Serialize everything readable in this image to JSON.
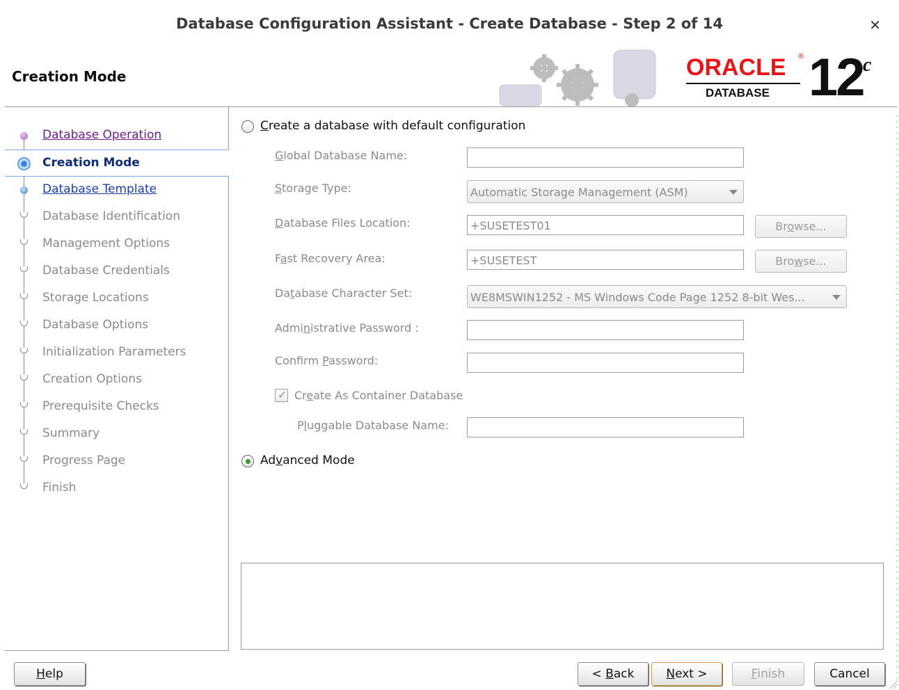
{
  "window": {
    "title": "Database Configuration Assistant - Create Database - Step 2 of 14",
    "close_glyph": "✕"
  },
  "header": {
    "page_heading": "Creation Mode",
    "brand": {
      "oracle_word": "ORACLE",
      "reg_mark": "®",
      "database_word": "DATABASE",
      "version": "12",
      "version_suffix": "c",
      "color": "#e8141a"
    }
  },
  "nav": {
    "items": [
      {
        "label": "Database Operation",
        "state": "visited"
      },
      {
        "label": "Creation Mode",
        "state": "current"
      },
      {
        "label": "Database Template",
        "state": "next"
      },
      {
        "label": "Database Identification",
        "state": "pending"
      },
      {
        "label": "Management Options",
        "state": "pending"
      },
      {
        "label": "Database Credentials",
        "state": "pending"
      },
      {
        "label": "Storage Locations",
        "state": "pending"
      },
      {
        "label": "Database Options",
        "state": "pending"
      },
      {
        "label": "Initialization Parameters",
        "state": "pending"
      },
      {
        "label": "Creation Options",
        "state": "pending"
      },
      {
        "label": "Prerequisite Checks",
        "state": "pending"
      },
      {
        "label": "Summary",
        "state": "pending"
      },
      {
        "label": "Progress Page",
        "state": "pending"
      },
      {
        "label": "Finish",
        "state": "pending"
      }
    ]
  },
  "form": {
    "default_config": {
      "label_mnemonic": "C",
      "label_rest": "reate a database with default configuration",
      "selected": false
    },
    "global_db_name": {
      "label_mnemonic": "G",
      "label_rest": "lobal Database Name:",
      "value": ""
    },
    "storage_type": {
      "label_mnemonic": "S",
      "label_rest": "torage Type:",
      "value": "Automatic Storage Management (ASM)"
    },
    "db_files_location": {
      "label_mnemonic": "D",
      "label_rest": "atabase Files Location:",
      "value": "+SUSETEST01",
      "browse_pre": "Br",
      "browse_mnemonic": "o",
      "browse_post": "wse..."
    },
    "fast_recovery_area": {
      "label_pre": "F",
      "label_mnemonic": "a",
      "label_rest": "st Recovery Area:",
      "value": "+SUSETEST",
      "browse_pre": "Bro",
      "browse_mnemonic": "w",
      "browse_post": "se..."
    },
    "charset": {
      "label_pre": "Da",
      "label_mnemonic": "t",
      "label_rest": "abase Character Set:",
      "value": "WE8MSWIN1252 - MS Windows Code Page 1252 8-bit Wes..."
    },
    "admin_password": {
      "label_pre": "Admi",
      "label_mnemonic": "n",
      "label_rest": "istrative Password :",
      "value": ""
    },
    "confirm_password": {
      "label_pre": "Confirm ",
      "label_mnemonic": "P",
      "label_rest": "assword:",
      "value": ""
    },
    "container_db": {
      "label_pre": "Cr",
      "label_mnemonic": "e",
      "label_rest": "ate As Container Database",
      "checked": true
    },
    "pluggable_db_name": {
      "label_pre": "P",
      "label_mnemonic": "l",
      "label_rest": "uggable Database Name:",
      "value": ""
    },
    "advanced_mode": {
      "label_pre": "Ad",
      "label_mnemonic": "v",
      "label_rest": "anced Mode",
      "selected": true
    }
  },
  "footer": {
    "help": {
      "mnemonic": "H",
      "rest": "elp"
    },
    "back": {
      "pre": "< ",
      "mnemonic": "B",
      "rest": "ack"
    },
    "next": {
      "mnemonic": "N",
      "rest": "ext >"
    },
    "finish": {
      "mnemonic": "F",
      "rest": "inish"
    },
    "cancel": {
      "label": "Cancel"
    }
  }
}
